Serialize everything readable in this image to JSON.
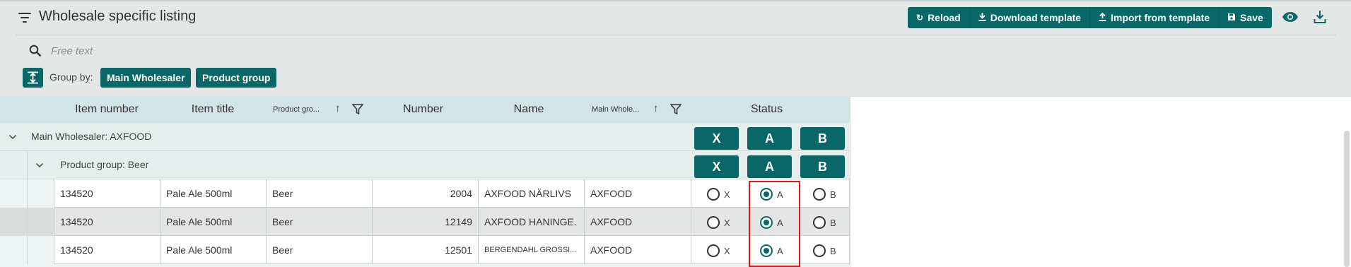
{
  "header": {
    "title": "Wholesale specific listing",
    "toolbar": {
      "reload": "Reload",
      "download_template": "Download template",
      "import_from_template": "Import from template",
      "save": "Save"
    }
  },
  "search": {
    "placeholder": "Free text"
  },
  "group_by": {
    "label": "Group by:",
    "chips": [
      "Main Wholesaler",
      "Product group"
    ]
  },
  "table": {
    "columns": {
      "item_number": "Item number",
      "item_title": "Item title",
      "product_group": "Product gro...",
      "number": "Number",
      "name": "Name",
      "main_wholesaler": "Main Whole...",
      "status": "Status"
    },
    "group_level1": {
      "label": "Main Wholesaler: AXFOOD"
    },
    "group_level2": {
      "label": "Product group: Beer"
    },
    "status_buttons": [
      "X",
      "A",
      "B"
    ],
    "rows": [
      {
        "item_number": "134520",
        "item_title": "Pale Ale 500ml",
        "product_group": "Beer",
        "number": "2004",
        "name": "AXFOOD NÄRLIVS",
        "main_wholesaler": "AXFOOD",
        "status": "A"
      },
      {
        "item_number": "134520",
        "item_title": "Pale Ale 500ml",
        "product_group": "Beer",
        "number": "12149",
        "name": "AXFOOD HANINGE.",
        "main_wholesaler": "AXFOOD",
        "status": "A"
      },
      {
        "item_number": "134520",
        "item_title": "Pale Ale 500ml",
        "product_group": "Beer",
        "number": "12501",
        "name": "BERGENDAHL GROSSI...",
        "main_wholesaler": "AXFOOD",
        "status": "A"
      }
    ],
    "status_options": [
      "X",
      "A",
      "B"
    ]
  },
  "icons": {
    "filter": "filter-lines-icon",
    "reload": "refresh-icon",
    "download": "download-icon",
    "import": "upload-icon",
    "save": "floppy-disk-icon",
    "visibility": "eye-icon",
    "export": "download-tray-icon",
    "search": "search-icon",
    "group_toggle": "expand-vertical-icon",
    "sort": "arrow-up-icon",
    "column_filter": "funnel-icon",
    "expand": "chevron-down-icon"
  },
  "colors": {
    "accent": "#0a6768",
    "header_bg": "#d1e5e6",
    "highlight": "#e0161b"
  }
}
